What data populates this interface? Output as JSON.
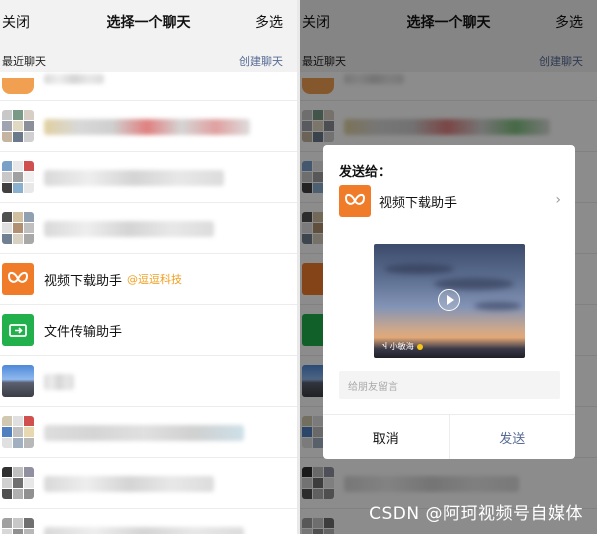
{
  "header": {
    "close": "关闭",
    "title": "选择一个聊天",
    "multi": "多选"
  },
  "section": {
    "label": "最近聊天",
    "create": "创建聊天"
  },
  "rows": {
    "video_helper": {
      "name": "视频下载助手",
      "tag": "@逗逗科技"
    },
    "file_helper": {
      "name": "文件传输助手"
    }
  },
  "dialog": {
    "send_to": "发送给：",
    "target_name": "视频下载助手",
    "video_label": "小敏海",
    "message_placeholder": "给朋友留言",
    "cancel": "取消",
    "send": "发送"
  },
  "watermark": "CSDN @阿珂视频号自媒体",
  "colors": {
    "accent_link": "#576b95",
    "tag_orange": "#f0a020",
    "logo_orange": "#f07c2a",
    "logo_green": "#21b04b"
  },
  "icons": {
    "video_helper": "butterfly-logo-icon",
    "file_helper": "folder-transfer-icon",
    "chevron": "chevron-right-icon",
    "play": "play-icon"
  }
}
